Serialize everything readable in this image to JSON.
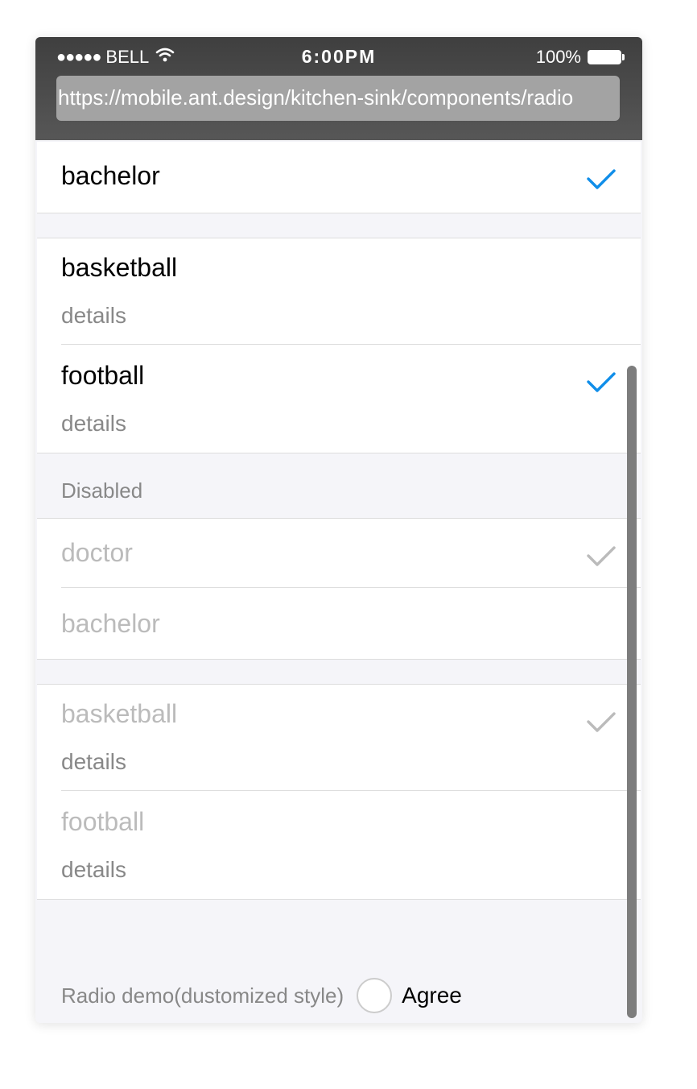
{
  "status_bar": {
    "signal": "●●●●●",
    "carrier": "BELL",
    "time": "6:00PM",
    "battery": "100%"
  },
  "browser": {
    "url": "https://mobile.ant.design/kitchen-sink/components/radio"
  },
  "list1": {
    "items": [
      {
        "label": "bachelor",
        "checked": true
      }
    ]
  },
  "list2": {
    "items": [
      {
        "label": "basketball",
        "brief": "details",
        "checked": false
      },
      {
        "label": "football",
        "brief": "details",
        "checked": true
      }
    ]
  },
  "disabled_section": {
    "title": "Disabled",
    "items": [
      {
        "label": "doctor",
        "checked": true
      },
      {
        "label": "bachelor",
        "checked": false
      }
    ]
  },
  "disabled_list2": {
    "items": [
      {
        "label": "basketball",
        "brief": "details",
        "checked": true
      },
      {
        "label": "football",
        "brief": "details",
        "checked": false
      }
    ]
  },
  "agree": {
    "description": "Radio demo(dustomized style)",
    "label": "Agree"
  },
  "colors": {
    "accent": "#108ee9",
    "disabled_check": "#bbbbbb"
  },
  "icons": {
    "check": "check-icon",
    "wifi": "wifi-icon",
    "battery": "battery-icon"
  }
}
